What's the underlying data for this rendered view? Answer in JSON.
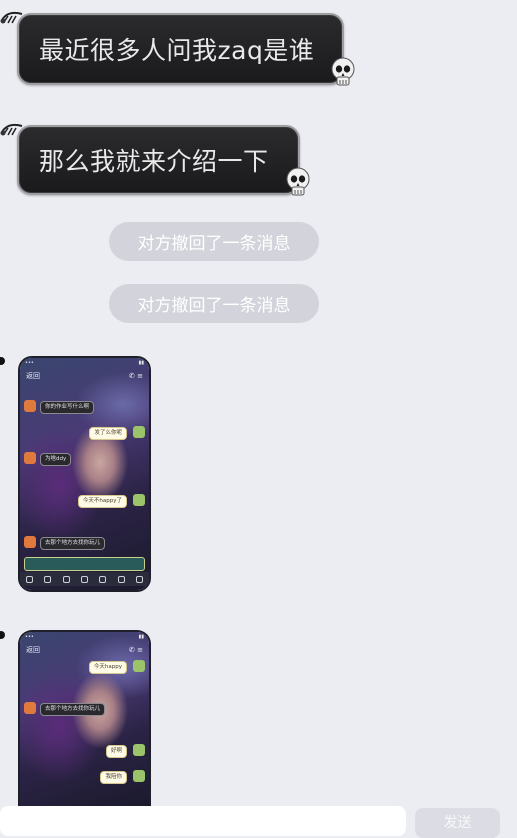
{
  "messages": [
    {
      "text": "最近很多人问我zaq是谁"
    },
    {
      "text": "那么我就来介绍一下"
    }
  ],
  "recalled": [
    {
      "text": "对方撤回了一条消息"
    },
    {
      "text": "对方撤回了一条消息"
    }
  ],
  "image1": {
    "nav_back": "返回",
    "items": [
      "你的作业写什么啊",
      "发了么你呢",
      "为啥ddy",
      "今天不happy了",
      "去那个地方去找你玩儿"
    ]
  },
  "image2": {
    "nav_back": "返回",
    "items": [
      "今天happy",
      "去那个地方去找你玩儿",
      "好啊",
      "我陪你"
    ]
  },
  "composer": {
    "send_label": "发送"
  },
  "colors": {
    "bubble": "#1f1f21",
    "recall": "#d3d4db",
    "background": "#ecedf2"
  }
}
